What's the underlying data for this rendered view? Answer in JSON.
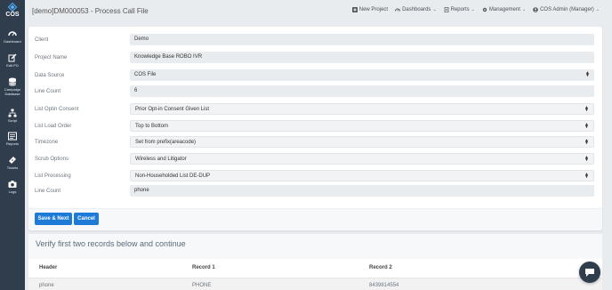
{
  "app": {
    "logo_text": "COS"
  },
  "sidebar": {
    "items": [
      {
        "label": "Dashboard",
        "icon": "dashboard-icon"
      },
      {
        "label": "Edit PO",
        "icon": "edit-icon"
      },
      {
        "label": "Campaign Database",
        "icon": "database-icon"
      },
      {
        "label": "Script",
        "icon": "sitemap-icon"
      },
      {
        "label": "Reports",
        "icon": "reports-icon"
      },
      {
        "label": "Tickets",
        "icon": "ticket-icon"
      },
      {
        "label": "Logs",
        "icon": "camera-icon"
      }
    ]
  },
  "header": {
    "title": "[demo]DM000053 - Process Call File",
    "nav": {
      "new_project": "New Project",
      "dashboards": "Dashboards",
      "reports": "Reports",
      "management": "Management",
      "user": "COS Admin (Manager)"
    }
  },
  "form": {
    "fields": [
      {
        "label": "Client",
        "value": "Demo"
      },
      {
        "label": "Project Name",
        "value": "Knowledge Base ROBO IVR"
      },
      {
        "label": "Data Source",
        "value": "COS File"
      },
      {
        "label": "Line Count",
        "value": "6"
      },
      {
        "label": "List Optin Consent",
        "value": "Prior Opt-in Consent Given List"
      },
      {
        "label": "List Load Order",
        "value": "Top to Bottom"
      },
      {
        "label": "Timezone",
        "value": "Set from prefix(areacode)"
      },
      {
        "label": "Scrub Options",
        "value": "Wireless and Litigator"
      },
      {
        "label": "List Processing",
        "value": "Non-Householded List DE-DUP"
      },
      {
        "label": "Line Count",
        "value": "phone"
      }
    ],
    "save_label": "Save & Next",
    "cancel_label": "Cancel"
  },
  "verify": {
    "title": "Verify first two records below and continue",
    "headers": [
      "Header",
      "Record 1",
      "Record 2"
    ],
    "rows": [
      [
        "phone",
        "PHONE",
        "8439814554"
      ]
    ]
  },
  "colors": {
    "sidebar_bg": "#2f3d4c",
    "primary_button": "#1d7bd7",
    "page_bg": "#e9ecef"
  }
}
